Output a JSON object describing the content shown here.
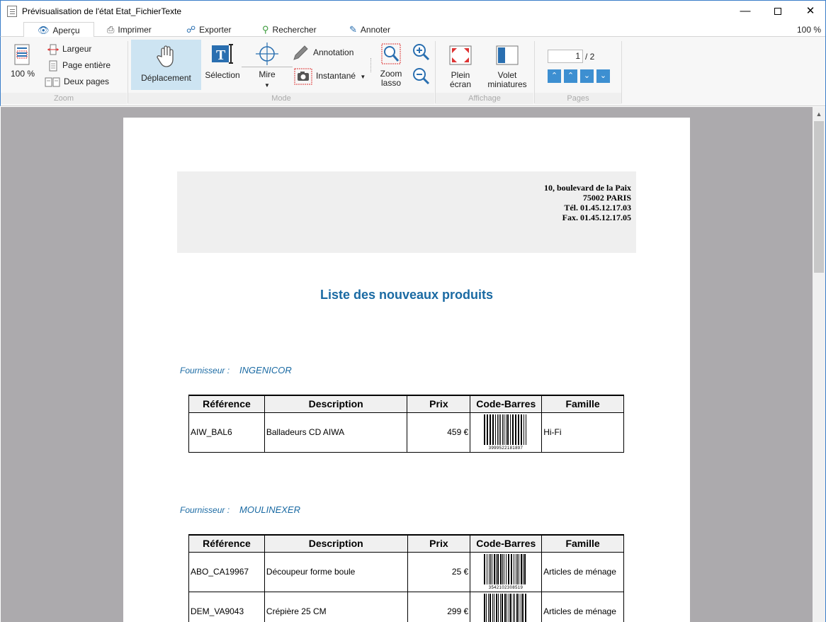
{
  "window": {
    "title": "Prévisualisation de l'état Etat_FichierTexte"
  },
  "tabs": [
    {
      "label": "Aperçu",
      "icon": "eye-icon"
    },
    {
      "label": "Imprimer",
      "icon": "printer-icon"
    },
    {
      "label": "Exporter",
      "icon": "share-icon"
    },
    {
      "label": "Rechercher",
      "icon": "search-icon"
    },
    {
      "label": "Annoter",
      "icon": "pen-icon"
    }
  ],
  "zoom_level": "100 %",
  "ribbon": {
    "zoom": {
      "group_label": "Zoom",
      "percent_label": "100 %",
      "largeur": "Largeur",
      "page_entiere": "Page entière",
      "deux_pages": "Deux pages"
    },
    "mode": {
      "group_label": "Mode",
      "deplacement": "Déplacement",
      "selection": "Sélection",
      "mire": "Mire",
      "annotation": "Annotation",
      "instantane": "Instantané",
      "zoom_lasso_1": "Zoom",
      "zoom_lasso_2": "lasso"
    },
    "affichage": {
      "group_label": "Affichage",
      "plein_ecran_1": "Plein",
      "plein_ecran_2": "écran",
      "volet_1": "Volet",
      "volet_2": "miniatures"
    },
    "pages": {
      "group_label": "Pages",
      "current": "1",
      "total": "/ 2"
    }
  },
  "report": {
    "address": [
      "10, boulevard de la Paix",
      "75002 PARIS",
      "Tél. 01.45.12.17.03",
      "Fax. 01.45.12.17.05"
    ],
    "title": "Liste des nouveaux produits",
    "supplier_label": "Fournisseur :",
    "columns": [
      "Référence",
      "Description",
      "Prix",
      "Code-Barres",
      "Famille"
    ],
    "groups": [
      {
        "supplier": "INGENICOR",
        "rows": [
          {
            "ref": "AIW_BAL6",
            "desc": "Balladeurs CD AIWA",
            "prix": "459 €",
            "barcode": "3999522181897",
            "famille": "Hi-Fi"
          }
        ]
      },
      {
        "supplier": "MOULINEXER",
        "rows": [
          {
            "ref": "ABO_CA19967",
            "desc": "Découpeur forme boule",
            "prix": "25 €",
            "barcode": "3542102308519",
            "famille": "Articles de ménage"
          },
          {
            "ref": "DEM_VA9043",
            "desc": "Crépière 25 CM",
            "prix": "299 €",
            "barcode": "",
            "famille": "Articles de ménage"
          }
        ]
      }
    ]
  }
}
